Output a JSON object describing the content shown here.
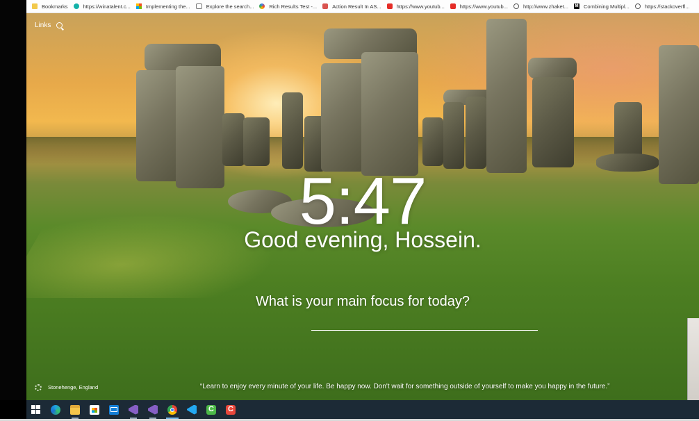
{
  "bookmarks": [
    {
      "label": "Bookmarks",
      "icon": "folder-icon"
    },
    {
      "label": "https://winatalent.c...",
      "icon": "winatalent-icon"
    },
    {
      "label": "Implementing the...",
      "icon": "microsoft-icon"
    },
    {
      "label": "Explore the search...",
      "icon": "code-icon"
    },
    {
      "label": "Rich Results Test -...",
      "icon": "google-icon"
    },
    {
      "label": "Action Result In AS...",
      "icon": "site-icon"
    },
    {
      "label": "https://www.youtub...",
      "icon": "youtube-icon"
    },
    {
      "label": "https://www.youtub...",
      "icon": "youtube-icon"
    },
    {
      "label": "http://www.zhaket...",
      "icon": "globe-icon"
    },
    {
      "label": "Combining Multipl...",
      "icon": "medium-icon"
    },
    {
      "label": "https://stackoverfl...",
      "icon": "globe-icon"
    }
  ],
  "links": {
    "label": "Links"
  },
  "clock": {
    "time": "5:47"
  },
  "greeting": {
    "text": "Good evening, Hossein."
  },
  "focus": {
    "question": "What is your main focus for today?",
    "value": ""
  },
  "footer": {
    "location": "Stonehenge, England",
    "quote": "“Learn to enjoy every minute of your life. Be happy now. Don't wait for something outside of yourself to make you happy in the future.”"
  },
  "taskbar": [
    {
      "name": "start-button",
      "icon": "windows-icon"
    },
    {
      "name": "edge-app",
      "icon": "edge-icon"
    },
    {
      "name": "file-explorer-app",
      "icon": "folder-icon"
    },
    {
      "name": "store-app",
      "icon": "store-icon"
    },
    {
      "name": "mail-app",
      "icon": "mail-icon"
    },
    {
      "name": "visual-studio-app",
      "icon": "visual-studio-icon"
    },
    {
      "name": "visual-studio-app-2",
      "icon": "visual-studio-icon"
    },
    {
      "name": "chrome-app",
      "icon": "chrome-icon"
    },
    {
      "name": "vscode-app",
      "icon": "vscode-icon"
    },
    {
      "name": "camtasia-app",
      "icon": "camtasia-icon"
    },
    {
      "name": "recorder-app",
      "icon": "recorder-icon"
    }
  ],
  "colors": {
    "taskbar": "#1c2a36",
    "text": "#ffffff",
    "grass": "#4d7f22",
    "sky": "#f2b84e"
  }
}
